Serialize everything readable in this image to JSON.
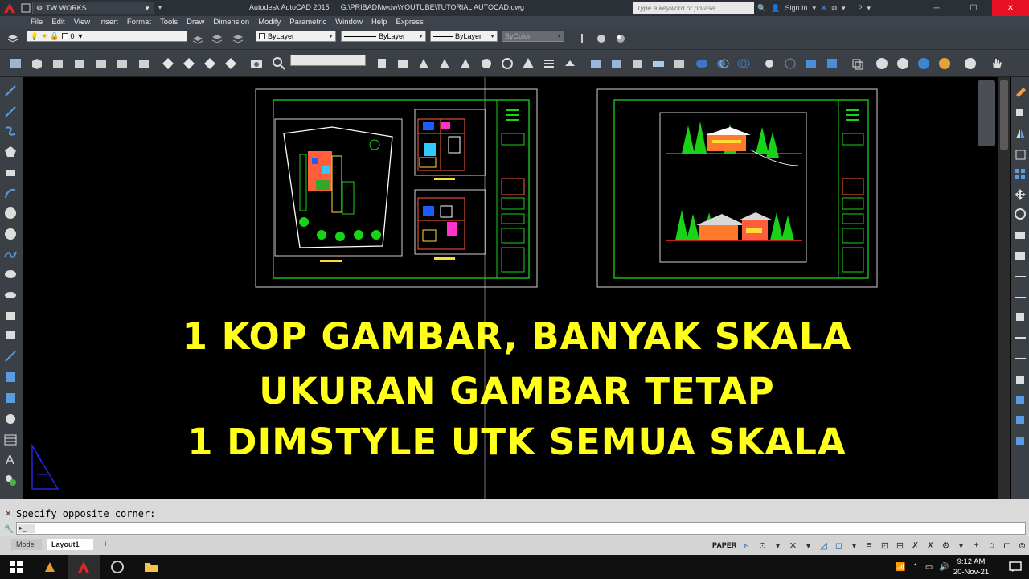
{
  "title_bar": {
    "workspace": "TW WORKS",
    "app_name": "Autodesk AutoCAD 2015",
    "file_path": "G:\\PRIBADI\\twdw\\YOUTUBE\\TUTORIAL AUTOCAD.dwg",
    "search_placeholder": "Type a keyword or phrase",
    "sign_in": "Sign In"
  },
  "menu": [
    "File",
    "Edit",
    "View",
    "Insert",
    "Format",
    "Tools",
    "Draw",
    "Dimension",
    "Modify",
    "Parametric",
    "Window",
    "Help",
    "Express"
  ],
  "properties": {
    "layer": "0",
    "color": "ByLayer",
    "linetype": "ByLayer",
    "lineweight": "ByLayer",
    "plotstyle": "ByColor"
  },
  "overlay": {
    "line1": "1 KOP GAMBAR, BANYAK SKALA",
    "line2": "UKURAN GAMBAR TETAP",
    "line3": "1 DIMSTYLE UTK SEMUA SKALA"
  },
  "command": {
    "history": "Specify opposite corner:"
  },
  "tabs": {
    "model": "Model",
    "layout": "Layout1",
    "add": "+"
  },
  "status": {
    "paper": "PAPER"
  },
  "taskbar": {
    "time": "9:12 AM",
    "date": "20-Nov-21"
  },
  "colors": {
    "overlay_text": "#ffff1a",
    "drawing_bg": "#000000",
    "border_green": "#19d319"
  }
}
